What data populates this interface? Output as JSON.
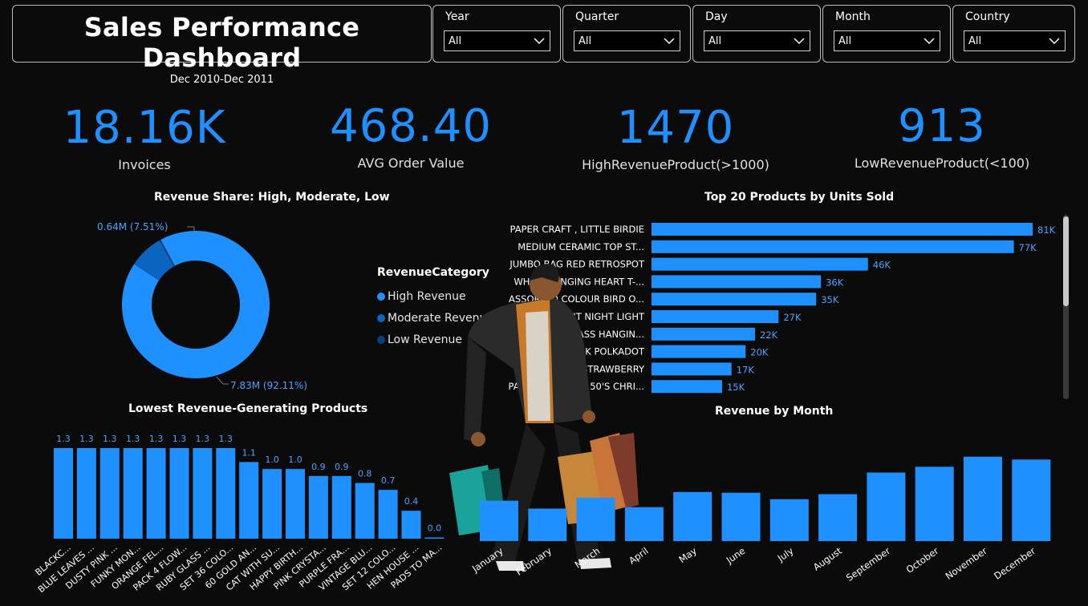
{
  "header": {
    "title": "Sales Performance Dashboard",
    "subtitle": "Dec 2010-Dec 2011"
  },
  "filters": [
    {
      "label": "Year",
      "value": "All"
    },
    {
      "label": "Quarter",
      "value": "All"
    },
    {
      "label": "Day",
      "value": "All"
    },
    {
      "label": "Month",
      "value": "All"
    },
    {
      "label": "Country",
      "value": "All"
    }
  ],
  "kpis": [
    {
      "value": "18.16K",
      "label": "Invoices"
    },
    {
      "value": "468.40",
      "label": "AVG Order Value"
    },
    {
      "value": "1470",
      "label": "HighRevenueProduct(>1000)"
    },
    {
      "value": "913",
      "label": "LowRevenueProduct(<100)"
    }
  ],
  "colors": {
    "accent": "#1e90ff",
    "moderate": "#0b64c0",
    "low": "#0a3f7a",
    "background": "#0b0b0b"
  },
  "chart_data": [
    {
      "type": "pie",
      "title": "Revenue Share: High, Moderate, Low",
      "legend_title": "RevenueCategory",
      "legend_position": "right",
      "slices": [
        {
          "name": "High Revenue",
          "value": 7.83,
          "label": "7.83M (92.11%)",
          "color": "#1e90ff"
        },
        {
          "name": "Moderate Revenue",
          "value": 0.64,
          "label": "0.64M (7.51%)",
          "color": "#0b64c0"
        },
        {
          "name": "Low Revenue",
          "value": 0.03,
          "label": "",
          "color": "#0a3f7a"
        }
      ]
    },
    {
      "type": "bar",
      "orientation": "horizontal",
      "title": "Top 20 Products by Units Sold",
      "categories": [
        "PAPER CRAFT , LITTLE BIRDIE",
        "MEDIUM CERAMIC TOP ST...",
        "JUMBO BAG RED RETROSPOT",
        "WHITE HANGING HEART T-...",
        "ASSORTED COLOUR BIRD O...",
        "RABBIT NIGHT LIGHT",
        "VICTORIAN GLASS HANGIN...",
        "JUMBO BAG PINK POLKADOT",
        "JUMBO BAG STRAWBERRY",
        "PAPER CHAIN KIT 50'S CHRI..."
      ],
      "values": [
        81,
        77,
        46,
        36,
        35,
        27,
        22,
        20,
        17,
        15
      ],
      "labels": [
        "81K",
        "77K",
        "46K",
        "36K",
        "35K",
        "27K",
        "22K",
        "20K",
        "17K",
        "15K"
      ],
      "xlim": [
        0,
        81
      ]
    },
    {
      "type": "bar",
      "title": "Lowest Revenue-Generating Products",
      "categories": [
        "BLACKC...",
        "BLUE LEAVES ...",
        "DUSTY PINK ...",
        "FUNKY MON...",
        "ORANGE FEL...",
        "PACK 4 FLOW...",
        "RUBY GLASS ...",
        "SET 36 COLO...",
        "60 GOLD AN...",
        "CAT WITH SU...",
        "HAPPY BIRTH...",
        "PINK CRYSTA...",
        "PURPLE FRA...",
        "VINTAGE BLU...",
        "SET 12 COLO...",
        "HEN HOUSE ...",
        "PADS TO MA..."
      ],
      "values": [
        1.3,
        1.3,
        1.3,
        1.3,
        1.3,
        1.3,
        1.3,
        1.3,
        1.1,
        1.0,
        1.0,
        0.9,
        0.9,
        0.8,
        0.7,
        0.4,
        0.0
      ],
      "labels": [
        "1.3",
        "1.3",
        "1.3",
        "1.3",
        "1.3",
        "1.3",
        "1.3",
        "1.3",
        "1.1",
        "1.0",
        "1.0",
        "0.9",
        "0.9",
        "0.8",
        "0.7",
        "0.4",
        "0.0"
      ],
      "ylim": [
        0,
        1.3
      ]
    },
    {
      "type": "bar",
      "title": "Revenue by Month",
      "categories": [
        "January",
        "February",
        "March",
        "April",
        "May",
        "June",
        "July",
        "August",
        "September",
        "October",
        "November",
        "December"
      ],
      "values": [
        0.56,
        0.45,
        0.6,
        0.47,
        0.68,
        0.67,
        0.58,
        0.65,
        0.95,
        1.03,
        1.17,
        1.13
      ]
    }
  ]
}
